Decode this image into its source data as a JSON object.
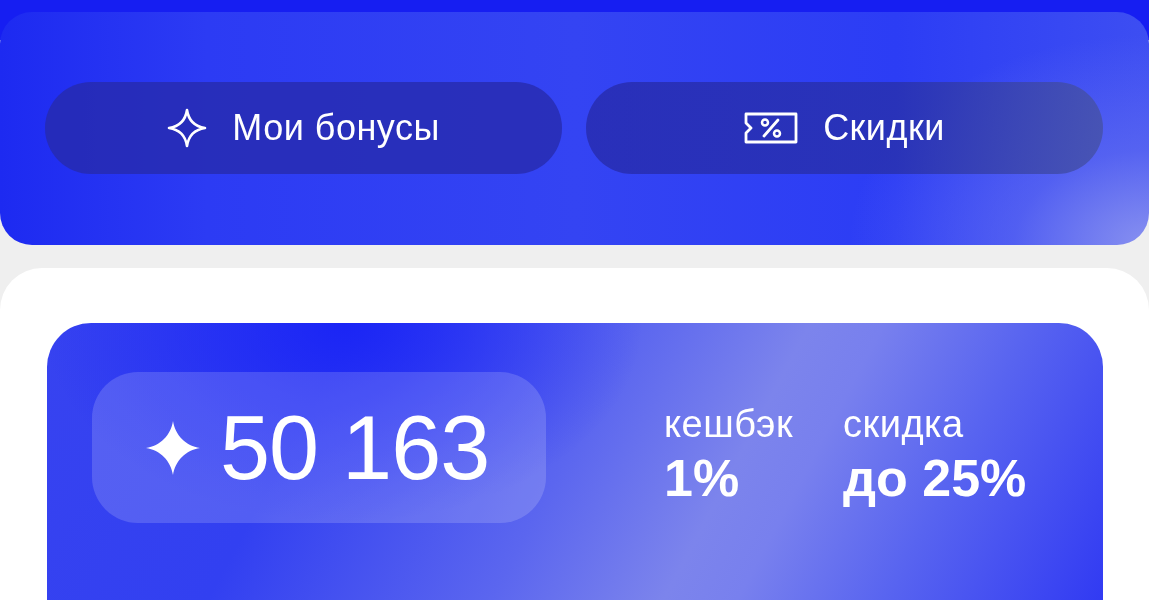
{
  "header_panel": {
    "buttons": [
      {
        "kind": "bonuses",
        "label": "Мои бонусы"
      },
      {
        "kind": "discounts",
        "label": "Скидки"
      }
    ]
  },
  "bonus_card": {
    "balance": "50 163",
    "stats": [
      {
        "label": "кешбэк",
        "value": "1%"
      },
      {
        "label": "скидка",
        "value": "до 25%"
      }
    ]
  }
}
